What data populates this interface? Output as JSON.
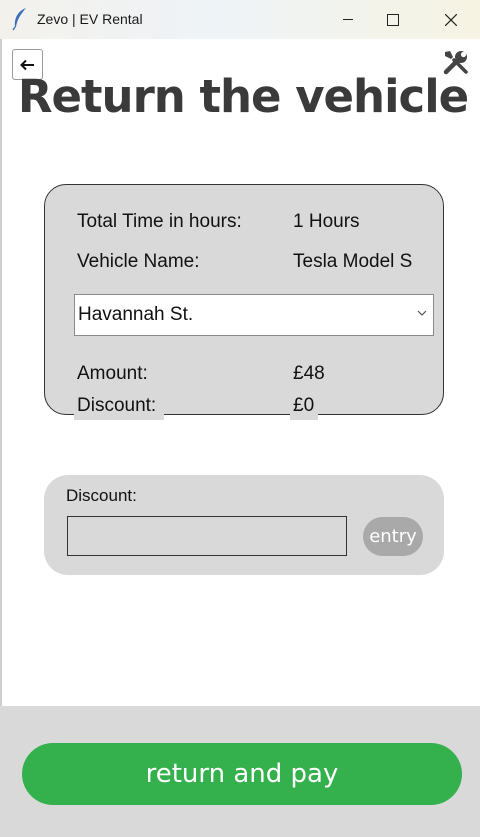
{
  "window": {
    "title": "Zevo | EV Rental",
    "icons": [
      "feather-icon",
      "minimize-icon",
      "maximize-icon",
      "close-icon"
    ]
  },
  "header": {
    "back_icon": "arrow-left-icon",
    "tools_icon": "tools-icon",
    "title": "Return the vehicle"
  },
  "info": {
    "time_label": "Total Time in hours:",
    "time_value": "1 Hours",
    "vehicle_label": "Vehicle Name:",
    "vehicle_value": "Tesla Model S",
    "location_selected": "Havannah St.",
    "amount_label": "Amount:",
    "amount_value": "£48",
    "discount_label": "Discount:",
    "discount_value": "£0"
  },
  "discount_entry": {
    "label": "Discount:",
    "value": "",
    "button": "entry"
  },
  "footer": {
    "pay_button": "return and pay"
  },
  "colors": {
    "accent_green": "#34b04d",
    "card_gray": "#d9d9d9",
    "title_text": "#3a3a3a"
  }
}
